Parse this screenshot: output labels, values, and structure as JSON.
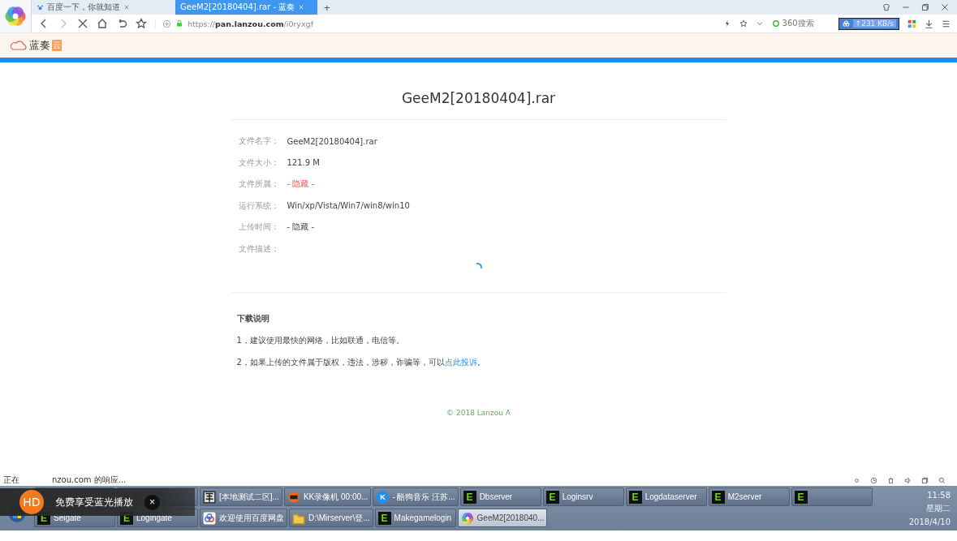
{
  "browser": {
    "tabs": [
      {
        "label": "百度一下，你就知道",
        "selected": false
      },
      {
        "label": "GeeM2[20180404].rar - 蓝奏",
        "selected": true
      }
    ],
    "new_tab": "+",
    "url": {
      "scheme": "https://",
      "host": "pan.lanzou.com",
      "path": "/i0ryxgf"
    },
    "search_engine": "360搜索",
    "speed": "↑231 KB/s"
  },
  "site": {
    "logo": "蓝奏",
    "logo_badge": "云"
  },
  "file": {
    "title": "GeeM2[20180404].rar",
    "fields": [
      {
        "label": "文件名字：",
        "value": "GeeM2[20180404].rar",
        "kind": "plain"
      },
      {
        "label": "文件大小：",
        "value": "121.9 M",
        "kind": "plain"
      },
      {
        "label": "文件所属：",
        "value": "- 隐藏 -",
        "kind": "alert"
      },
      {
        "label": "运行系统：",
        "value": "Win/xp/Vista/Win7/win8/win10",
        "kind": "plain"
      },
      {
        "label": "上传时间：",
        "value": "- 隐藏 -",
        "kind": "plain"
      },
      {
        "label": "文件描述：",
        "kind": "plain"
      }
    ]
  },
  "notes": {
    "heading": "下载说明",
    "lines": [
      {
        "text": "1，建议使用最快的网络，比如联通，电信等。"
      },
      {
        "text": "2，如果上传的文件属于版权，违法，涉秽，诈骗等，可以",
        "link": "点此投诉",
        "after": "。"
      }
    ]
  },
  "footer": "© 2018 Lanzou A",
  "status": {
    "start": "正在",
    "end": "nzou.com 的响应..."
  },
  "overlay": {
    "badge": "HD",
    "text": "免费享受蓝光播放",
    "close": "×"
  },
  "taskbar": {
    "rows": [
      [
        {
          "kind": "hidden"
        },
        {
          "kind": "hidden"
        },
        {
          "kind": "dragon",
          "label": "[本地测试二区]...",
          "selected": false
        },
        {
          "kind": "kk",
          "label": "KK录像机 00:00...",
          "selected": false
        },
        {
          "kind": "kugou",
          "glyph": "K",
          "label": "- 酷狗音乐 汪苏...",
          "selected": false
        },
        {
          "kind": "e",
          "glyph": "E",
          "label": "Dbserver",
          "selected": false
        },
        {
          "kind": "e",
          "glyph": "E",
          "label": "Loginsrv",
          "selected": false
        },
        {
          "kind": "e",
          "glyph": "E",
          "label": "Logdataserver",
          "selected": false
        },
        {
          "kind": "e",
          "glyph": "E",
          "label": "M2server",
          "selected": false
        },
        {
          "kind": "e",
          "glyph": "E",
          "selected": false
        }
      ],
      [
        {
          "kind": "e",
          "glyph": "E",
          "label": "Selgate",
          "selected": false
        },
        {
          "kind": "e",
          "glyph": "E",
          "label": "Logingate",
          "selected": false
        },
        {
          "kind": "cloud",
          "label": "欢迎使用百度网盘",
          "selected": false
        },
        {
          "kind": "folder",
          "label": "D:\\Mirserver\\登...",
          "selected": false
        },
        {
          "kind": "e",
          "glyph": "E",
          "label": "Makegamelogin",
          "selected": false
        },
        {
          "kind": "browser",
          "label": "GeeM2[2018040...",
          "selected": true
        }
      ]
    ],
    "time": "11:58",
    "weekday": "星期二",
    "date": "2018/4/10"
  }
}
